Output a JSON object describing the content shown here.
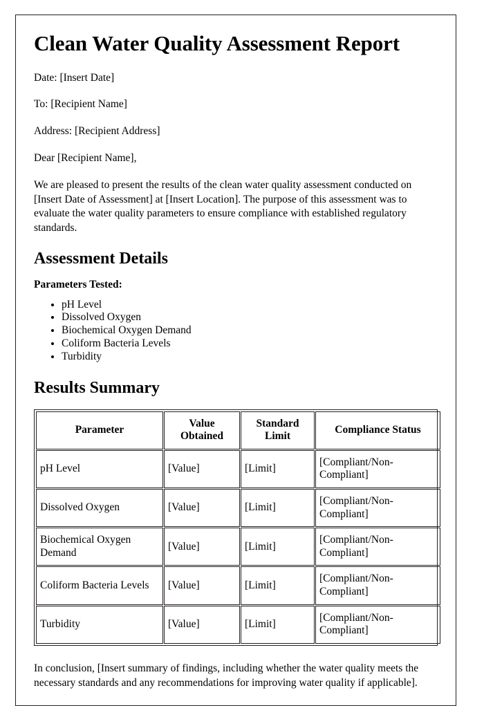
{
  "document": {
    "title": "Clean Water Quality Assessment Report",
    "header_fields": [
      "Date: [Insert Date]",
      "To: [Recipient Name]",
      "Address: [Recipient Address]",
      "Dear [Recipient Name],"
    ],
    "intro_paragraph": "We are pleased to present the results of the clean water quality assessment conducted on [Insert Date of Assessment] at [Insert Location]. The purpose of this assessment was to evaluate the water quality parameters to ensure compliance with established regulatory standards.",
    "assessment_details": {
      "heading": "Assessment Details",
      "parameters_label": "Parameters Tested:",
      "parameters": [
        "pH Level",
        "Dissolved Oxygen",
        "Biochemical Oxygen Demand",
        "Coliform Bacteria Levels",
        "Turbidity"
      ]
    },
    "results_summary": {
      "heading": "Results Summary",
      "columns": [
        "Parameter",
        "Value Obtained",
        "Standard Limit",
        "Compliance Status"
      ],
      "rows": [
        {
          "parameter": "pH Level",
          "value": "[Value]",
          "limit": "[Limit]",
          "status": "[Compliant/Non-Compliant]"
        },
        {
          "parameter": "Dissolved Oxygen",
          "value": "[Value]",
          "limit": "[Limit]",
          "status": "[Compliant/Non-Compliant]"
        },
        {
          "parameter": "Biochemical Oxygen Demand",
          "value": "[Value]",
          "limit": "[Limit]",
          "status": "[Compliant/Non-Compliant]"
        },
        {
          "parameter": "Coliform Bacteria Levels",
          "value": "[Value]",
          "limit": "[Limit]",
          "status": "[Compliant/Non-Compliant]"
        },
        {
          "parameter": "Turbidity",
          "value": "[Value]",
          "limit": "[Limit]",
          "status": "[Compliant/Non-Compliant]"
        }
      ]
    },
    "conclusion": "In conclusion, [Insert summary of findings, including whether the water quality meets the necessary standards and any recommendations for improving water quality if applicable]."
  },
  "colors": {
    "text": "#000000",
    "border": "#231f20",
    "page_background": "#ffffff"
  }
}
